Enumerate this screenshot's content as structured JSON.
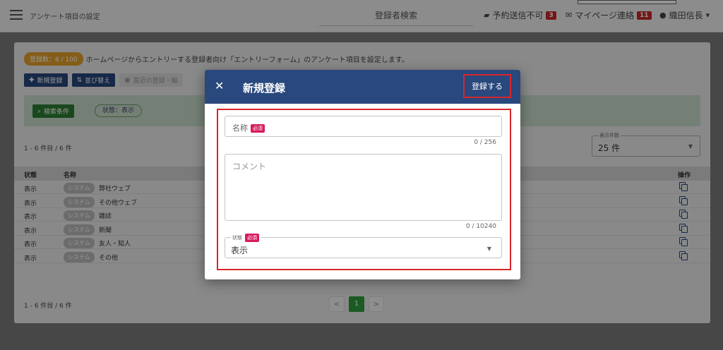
{
  "header": {
    "title": "アンケート項目の設定",
    "search_label": "登録者検索",
    "reservation": {
      "label": "予約送信不可",
      "count": "3"
    },
    "mypage": {
      "label": "マイページ連絡",
      "count": "11"
    },
    "user": {
      "name": "織田信長"
    }
  },
  "page": {
    "count_label": "登録数：6 / 100",
    "description": "ホームページからエントリーする登録者向け「エントリーフォーム」のアンケート項目を設定します。",
    "buttons": {
      "new": "新規登録",
      "sort": "並び替え",
      "recent": "直近の登録・編"
    },
    "filter": {
      "search_button": "検索条件",
      "state_pill": "状態：表示"
    },
    "result_count": "1 - 6 件目 / 6 件",
    "per_page": {
      "label": "表示件数",
      "value": "25 件"
    },
    "table": {
      "headers": {
        "state": "状態",
        "name": "名称",
        "ops": "操作"
      },
      "system_tag": "システム",
      "rows": [
        {
          "state": "表示",
          "name": "弊社ウェブ"
        },
        {
          "state": "表示",
          "name": "その他ウェブ"
        },
        {
          "state": "表示",
          "name": "雑誌"
        },
        {
          "state": "表示",
          "name": "新聞"
        },
        {
          "state": "表示",
          "name": "友人・知人"
        },
        {
          "state": "表示",
          "name": "その他"
        }
      ]
    },
    "pager": {
      "prev": "<",
      "current": "1",
      "next": ">"
    }
  },
  "modal": {
    "title": "新規登録",
    "submit_label": "登録する",
    "name_label": "名称",
    "required_tag": "必須",
    "name_counter": "0 / 256",
    "comment_placeholder": "コメント",
    "comment_counter": "0 / 10240",
    "state_label": "状態",
    "state_value": "表示"
  },
  "colors": {
    "primary": "#29487d",
    "accent_red": "#d8262c",
    "pill_orange": "#e6a02c",
    "green": "#2e7d32"
  }
}
